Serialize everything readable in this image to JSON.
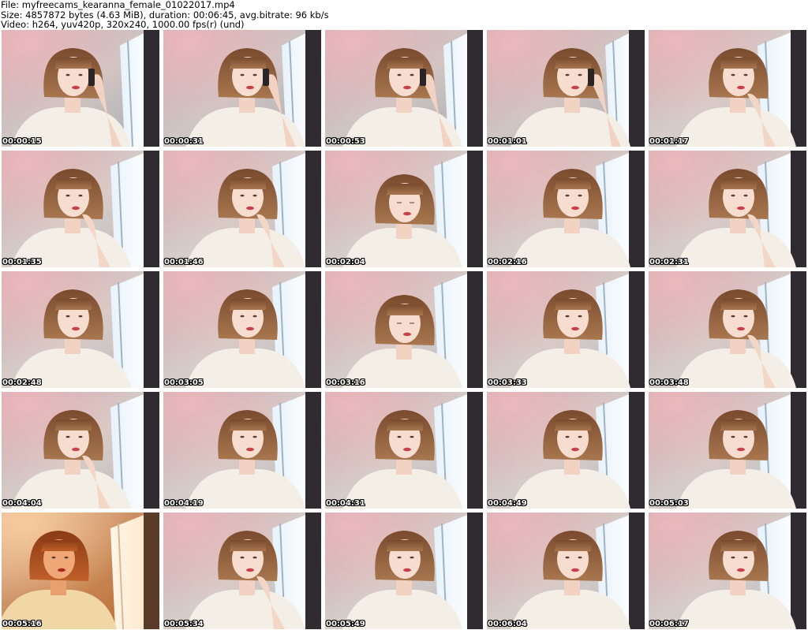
{
  "header": {
    "file_line": "File: myfreecams_kearanna_female_01022017.mp4",
    "size_line": "Size: 4857872 bytes (4.63 MiB), duration: 00:06:45, avg.bitrate: 96 kb/s",
    "video_line": "Video: h264, yuv420p, 320x240, 1000.00 fps(r) (und)"
  },
  "thumbnails": [
    {
      "timestamp": "00:00:15",
      "pose": "phone",
      "tone": "cool"
    },
    {
      "timestamp": "00:00:31",
      "pose": "phone",
      "tone": "cool"
    },
    {
      "timestamp": "00:00:53",
      "pose": "phone",
      "tone": "cool"
    },
    {
      "timestamp": "00:01:01",
      "pose": "phone",
      "tone": "cool"
    },
    {
      "timestamp": "00:01:17",
      "pose": "hand-chin",
      "tone": "bright"
    },
    {
      "timestamp": "00:01:35",
      "pose": "hand-chin",
      "tone": "bright"
    },
    {
      "timestamp": "00:01:46",
      "pose": "hand-chin",
      "tone": "bright"
    },
    {
      "timestamp": "00:02:04",
      "pose": "looking-down",
      "tone": "bright"
    },
    {
      "timestamp": "00:02:16",
      "pose": "neutral",
      "tone": "bright"
    },
    {
      "timestamp": "00:02:31",
      "pose": "hand-chin",
      "tone": "bright"
    },
    {
      "timestamp": "00:02:48",
      "pose": "neutral",
      "tone": "bright"
    },
    {
      "timestamp": "00:03:05",
      "pose": "neutral",
      "tone": "bright"
    },
    {
      "timestamp": "00:03:16",
      "pose": "looking-down",
      "tone": "bright"
    },
    {
      "timestamp": "00:03:33",
      "pose": "neutral",
      "tone": "bright"
    },
    {
      "timestamp": "00:03:48",
      "pose": "hand-chin",
      "tone": "bright"
    },
    {
      "timestamp": "00:04:04",
      "pose": "hand-chin",
      "tone": "bright"
    },
    {
      "timestamp": "00:04:19",
      "pose": "neutral",
      "tone": "bright"
    },
    {
      "timestamp": "00:04:31",
      "pose": "neutral",
      "tone": "bright"
    },
    {
      "timestamp": "00:04:49",
      "pose": "neutral",
      "tone": "bright"
    },
    {
      "timestamp": "00:05:03",
      "pose": "neutral",
      "tone": "bright"
    },
    {
      "timestamp": "00:05:16",
      "pose": "neutral",
      "tone": "warm"
    },
    {
      "timestamp": "00:05:34",
      "pose": "hand-chin",
      "tone": "bright"
    },
    {
      "timestamp": "00:05:49",
      "pose": "neutral",
      "tone": "bright"
    },
    {
      "timestamp": "00:06:04",
      "pose": "neutral",
      "tone": "bright"
    },
    {
      "timestamp": "00:06:17",
      "pose": "neutral",
      "tone": "bright"
    }
  ]
}
